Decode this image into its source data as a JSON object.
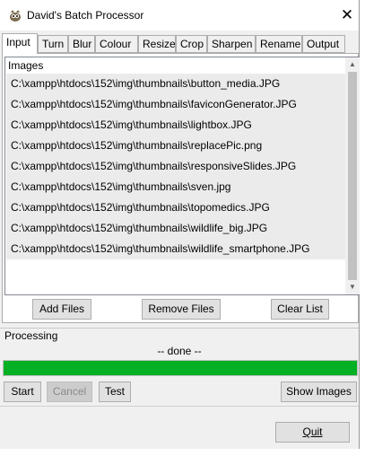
{
  "window": {
    "title": "David's Batch Processor",
    "close_symbol": "✕"
  },
  "tabs": [
    {
      "label": "Input",
      "active": true
    },
    {
      "label": "Turn"
    },
    {
      "label": "Blur"
    },
    {
      "label": "Colour"
    },
    {
      "label": "Resize"
    },
    {
      "label": "Crop"
    },
    {
      "label": "Sharpen"
    },
    {
      "label": "Rename"
    },
    {
      "label": "Output"
    }
  ],
  "images": {
    "header": "Images",
    "files": [
      "C:\\xampp\\htdocs\\152\\img\\thumbnails\\button_media.JPG",
      "C:\\xampp\\htdocs\\152\\img\\thumbnails\\faviconGenerator.JPG",
      "C:\\xampp\\htdocs\\152\\img\\thumbnails\\lightbox.JPG",
      "C:\\xampp\\htdocs\\152\\img\\thumbnails\\replacePic.png",
      "C:\\xampp\\htdocs\\152\\img\\thumbnails\\responsiveSlides.JPG",
      "C:\\xampp\\htdocs\\152\\img\\thumbnails\\sven.jpg",
      "C:\\xampp\\htdocs\\152\\img\\thumbnails\\topomedics.JPG",
      "C:\\xampp\\htdocs\\152\\img\\thumbnails\\wildlife_big.JPG",
      "C:\\xampp\\htdocs\\152\\img\\thumbnails\\wildlife_smartphone.JPG"
    ],
    "add_label": "Add Files",
    "remove_label": "Remove Files",
    "clear_label": "Clear List"
  },
  "processing": {
    "label": "Processing",
    "status": "-- done --",
    "progress_percent": 100,
    "progress_color": "#06b025",
    "start_label": "Start",
    "cancel_label": "Cancel",
    "test_label": "Test",
    "show_images_label": "Show Images"
  },
  "footer": {
    "quit_label": "Quit"
  }
}
